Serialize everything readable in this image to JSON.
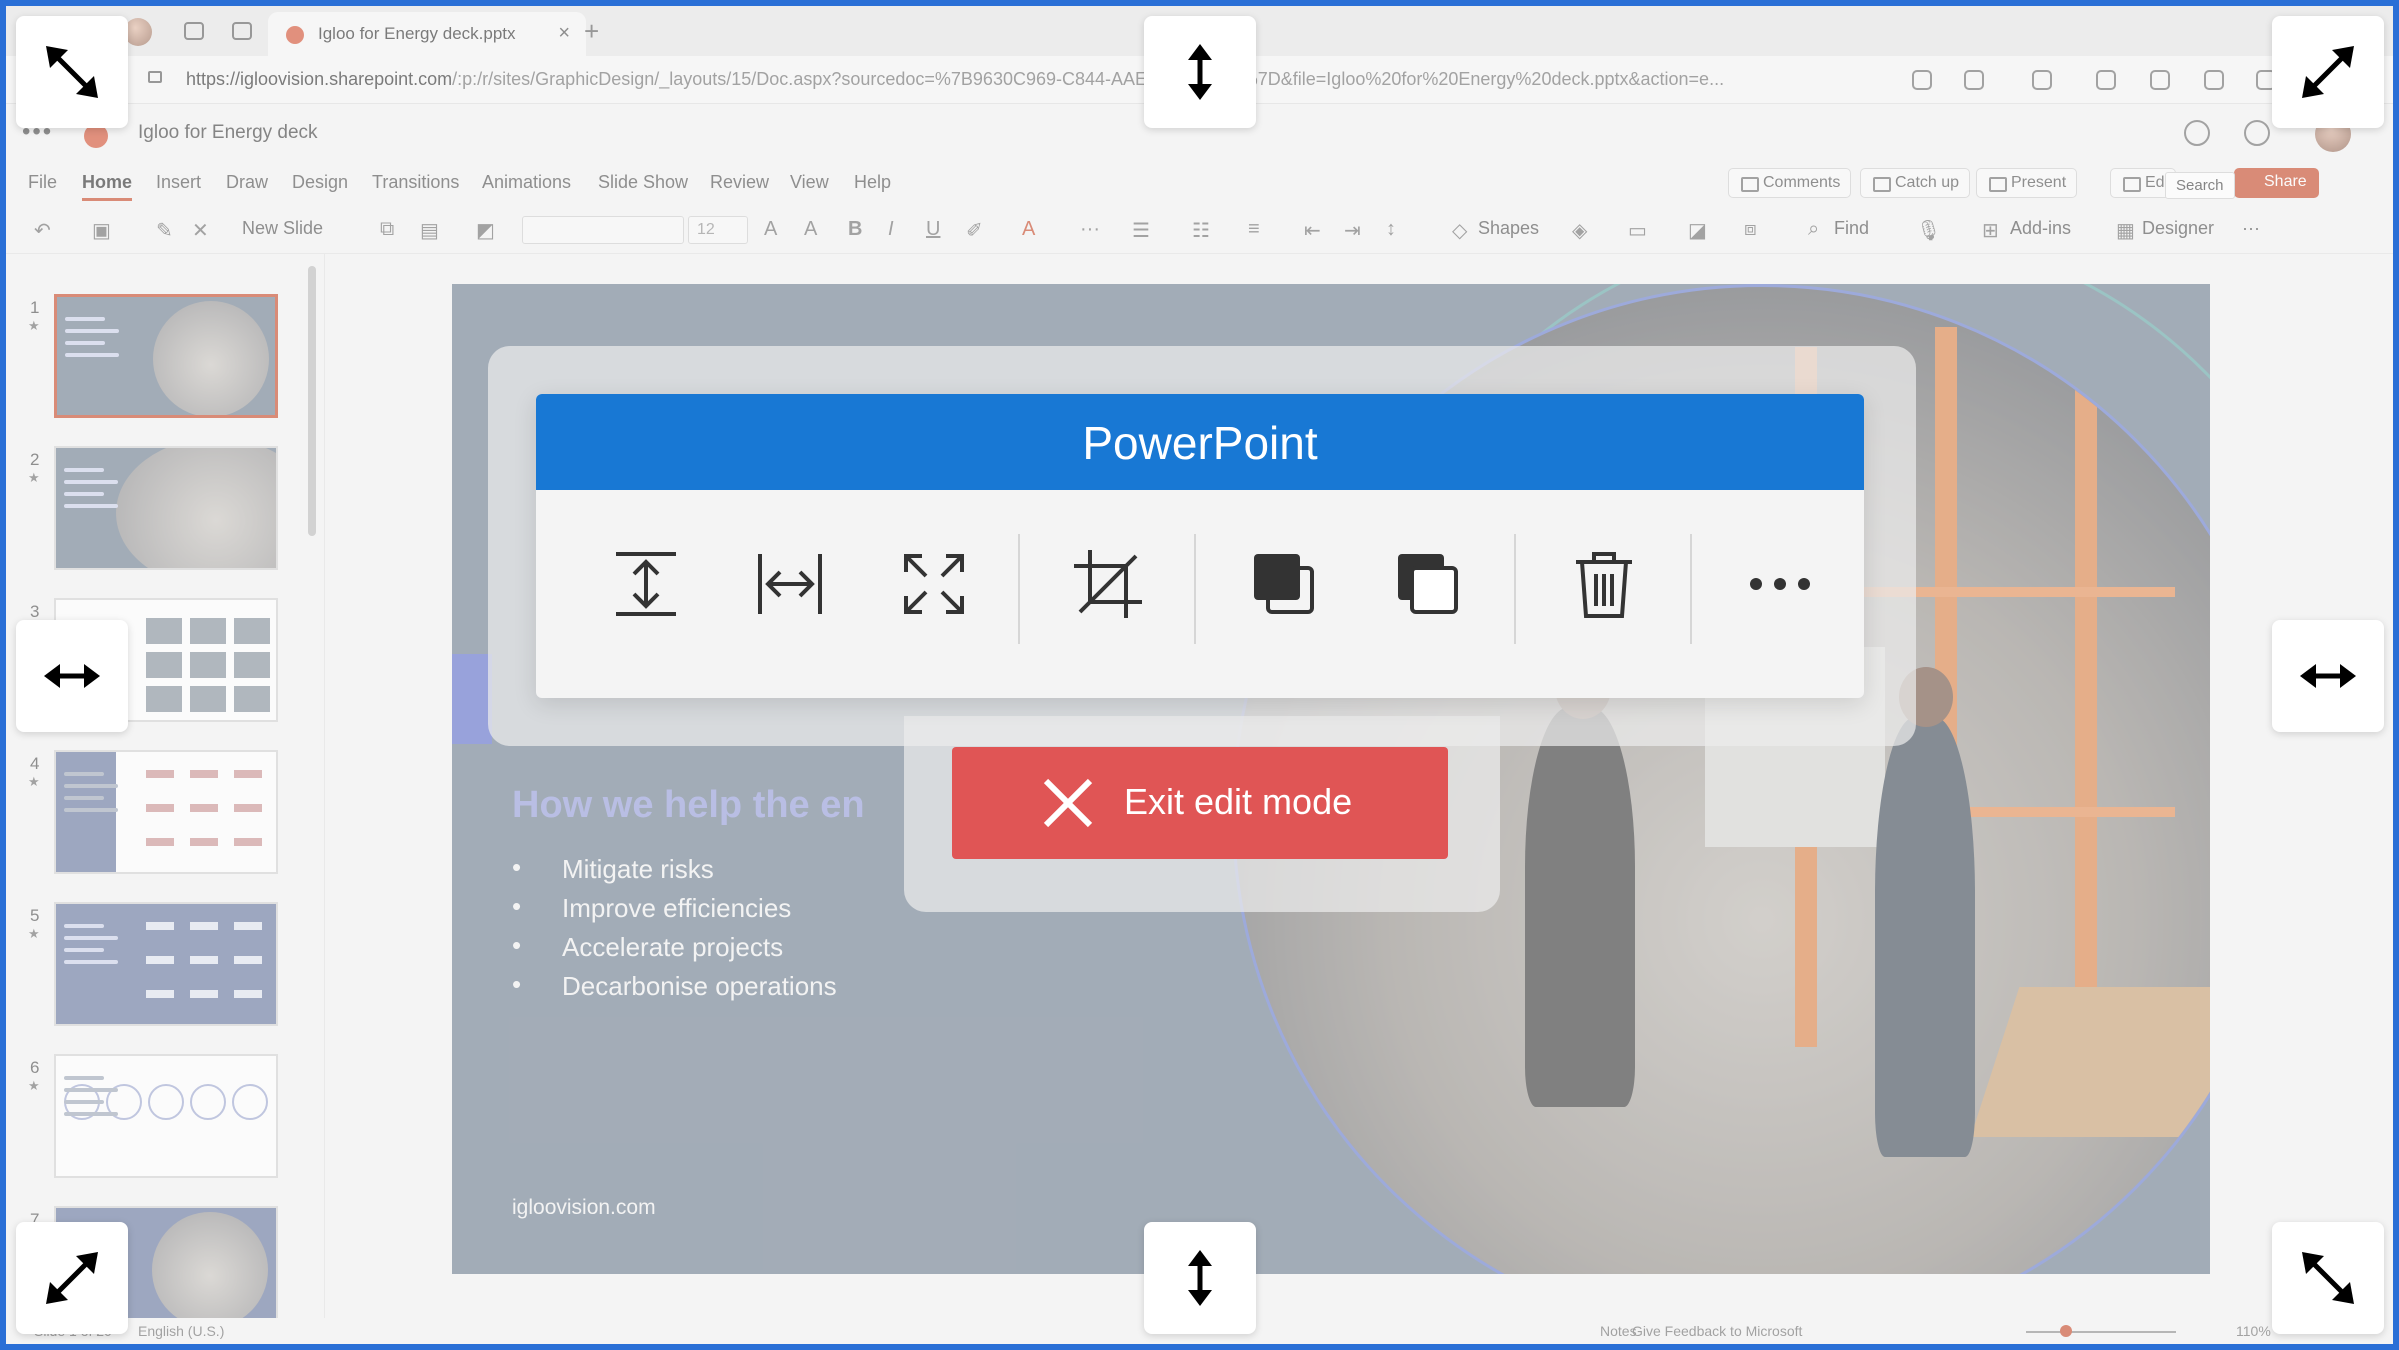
{
  "browser": {
    "tab_title": "Igloo for Energy deck.pptx",
    "tab_close": "×",
    "new_tab": "+",
    "url_host": "https://igloovision.sharepoint.com",
    "url_path": "/:p:/r/sites/GraphicDesign/_layouts/15/Doc.aspx?sourcedoc=%7B9630C969-C844-AAE11F8003BC%7D&file=Igloo%20for%20Energy%20deck.pptx&action=e..."
  },
  "app": {
    "waffle": "•••",
    "doc_title": "Igloo for Energy deck",
    "menu": [
      "File",
      "Home",
      "Insert",
      "Draw",
      "Design",
      "Transitions",
      "Animations",
      "Slide Show",
      "Review",
      "View",
      "Help"
    ],
    "active_menu": "Home",
    "comments": "Comments",
    "catch_up": "Catch up",
    "present": "Present",
    "edit": "Ed",
    "share": "Share",
    "search_tooltip": "Search"
  },
  "toolbar": {
    "new_slide": "New Slide",
    "font_size": "12",
    "shapes": "Shapes",
    "find": "Find",
    "add_ins": "Add-ins",
    "designer": "Designer",
    "more": "···"
  },
  "thumbnails": [
    {
      "num": "1",
      "bg": "#67788a"
    },
    {
      "num": "2",
      "bg": "#67788a"
    },
    {
      "num": "3",
      "bg": "#ffffff"
    },
    {
      "num": "4",
      "bg": "#ffffff"
    },
    {
      "num": "5",
      "bg": "#5e6f9a"
    },
    {
      "num": "6",
      "bg": "#ffffff"
    },
    {
      "num": "7",
      "bg": "#5e6f9a"
    }
  ],
  "slide": {
    "heading": "How we help the en",
    "bullets": [
      "Mitigate risks",
      "Improve efficiencies",
      "Accelerate projects",
      "Decarbonise operations"
    ],
    "footer": "igloovision.com"
  },
  "status": {
    "slide_count": "Slide 1 of 20",
    "language": "English (U.S.)",
    "notes": "Notes",
    "feedback": "Give Feedback to Microsoft",
    "zoom": "110%"
  },
  "overlay": {
    "title": "PowerPoint",
    "tools": [
      "fit-height-icon",
      "fit-width-icon",
      "fullscreen-icon",
      "crop-icon",
      "bring-forward-icon",
      "send-backward-icon",
      "delete-icon",
      "more-icon"
    ],
    "exit_label": "Exit edit mode",
    "accent_blue": "#1878d4",
    "exit_red": "#e05555"
  }
}
